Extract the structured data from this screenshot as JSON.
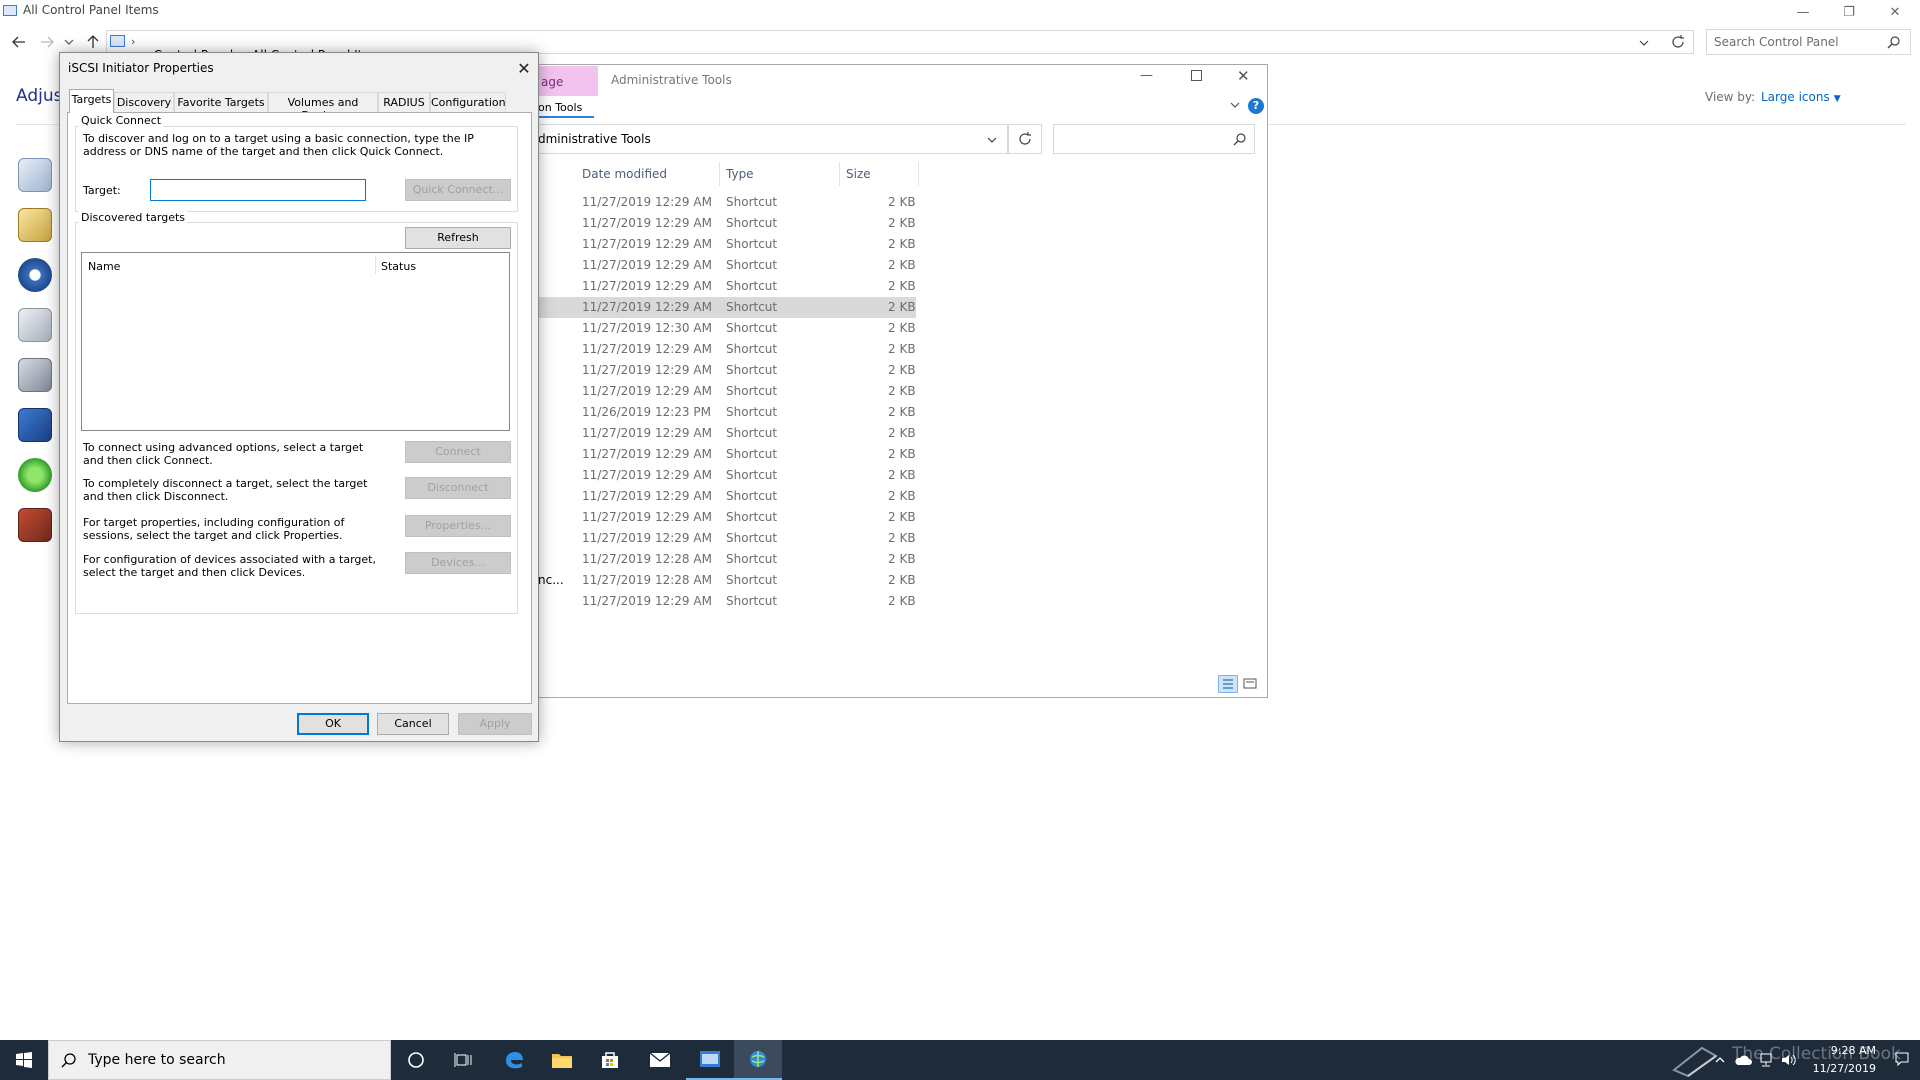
{
  "control_panel": {
    "title": "All Control Panel Items",
    "breadcrumb": [
      "Control Panel",
      "All Control Panel Items"
    ],
    "search_placeholder": "Search Control Panel",
    "heading_partial": "Adjust",
    "view_by_label": "View by:",
    "view_by_value": "Large icons"
  },
  "admin_tools": {
    "ribbon_tab_partial": "age",
    "title": "Administrative Tools",
    "subtab_partial": "on Tools",
    "address_partial": "dministrative Tools",
    "columns": [
      "Date modified",
      "Type",
      "Size"
    ],
    "rows": [
      {
        "name": "",
        "date": "11/27/2019 12:29 AM",
        "type": "Shortcut",
        "size": "2 KB"
      },
      {
        "name": "",
        "date": "11/27/2019 12:29 AM",
        "type": "Shortcut",
        "size": "2 KB"
      },
      {
        "name": "",
        "date": "11/27/2019 12:29 AM",
        "type": "Shortcut",
        "size": "2 KB"
      },
      {
        "name": "",
        "date": "11/27/2019 12:29 AM",
        "type": "Shortcut",
        "size": "2 KB"
      },
      {
        "name": "",
        "date": "11/27/2019 12:29 AM",
        "type": "Shortcut",
        "size": "2 KB"
      },
      {
        "name": "",
        "date": "11/27/2019 12:29 AM",
        "type": "Shortcut",
        "size": "2 KB",
        "selected": true
      },
      {
        "name": "",
        "date": "11/27/2019 12:30 AM",
        "type": "Shortcut",
        "size": "2 KB"
      },
      {
        "name": "",
        "date": "11/27/2019 12:29 AM",
        "type": "Shortcut",
        "size": "2 KB"
      },
      {
        "name": "",
        "date": "11/27/2019 12:29 AM",
        "type": "Shortcut",
        "size": "2 KB"
      },
      {
        "name": "",
        "date": "11/27/2019 12:29 AM",
        "type": "Shortcut",
        "size": "2 KB"
      },
      {
        "name": "",
        "date": "11/26/2019 12:23 PM",
        "type": "Shortcut",
        "size": "2 KB"
      },
      {
        "name": "",
        "date": "11/27/2019 12:29 AM",
        "type": "Shortcut",
        "size": "2 KB"
      },
      {
        "name": "",
        "date": "11/27/2019 12:29 AM",
        "type": "Shortcut",
        "size": "2 KB"
      },
      {
        "name": "",
        "date": "11/27/2019 12:29 AM",
        "type": "Shortcut",
        "size": "2 KB"
      },
      {
        "name": "",
        "date": "11/27/2019 12:29 AM",
        "type": "Shortcut",
        "size": "2 KB"
      },
      {
        "name": "",
        "date": "11/27/2019 12:29 AM",
        "type": "Shortcut",
        "size": "2 KB"
      },
      {
        "name": "",
        "date": "11/27/2019 12:29 AM",
        "type": "Shortcut",
        "size": "2 KB"
      },
      {
        "name": "",
        "date": "11/27/2019 12:28 AM",
        "type": "Shortcut",
        "size": "2 KB"
      },
      {
        "name": "nc...",
        "date": "11/27/2019 12:28 AM",
        "type": "Shortcut",
        "size": "2 KB"
      },
      {
        "name": "",
        "date": "11/27/2019 12:29 AM",
        "type": "Shortcut",
        "size": "2 KB"
      }
    ]
  },
  "iscsi": {
    "title": "iSCSI Initiator Properties",
    "tabs": [
      "Targets",
      "Discovery",
      "Favorite Targets",
      "Volumes and Devices",
      "RADIUS",
      "Configuration"
    ],
    "active_tab": "Targets",
    "quick_connect": {
      "group_label": "Quick Connect",
      "description": "To discover and log on to a target using a basic connection, type the IP address or DNS name of the target and then click Quick Connect.",
      "target_label": "Target:",
      "target_value": "",
      "button": "Quick Connect..."
    },
    "discovered": {
      "group_label": "Discovered targets",
      "refresh_button": "Refresh",
      "columns": [
        "Name",
        "Status"
      ],
      "items": []
    },
    "actions": [
      {
        "text": "To connect using advanced options, select a target and then click Connect.",
        "button": "Connect"
      },
      {
        "text": "To completely disconnect a target, select the target and then click Disconnect.",
        "button": "Disconnect"
      },
      {
        "text": "For target properties, including configuration of sessions, select the target and click Properties.",
        "button": "Properties..."
      },
      {
        "text": "For configuration of devices associated with a target, select the target and then click Devices.",
        "button": "Devices..."
      }
    ],
    "footer": {
      "ok": "OK",
      "cancel": "Cancel",
      "apply": "Apply"
    }
  },
  "taskbar": {
    "search_placeholder": "Type here to search",
    "time": "9:28 AM",
    "date": "11/27/2019",
    "watermark": "The Collection Book"
  }
}
